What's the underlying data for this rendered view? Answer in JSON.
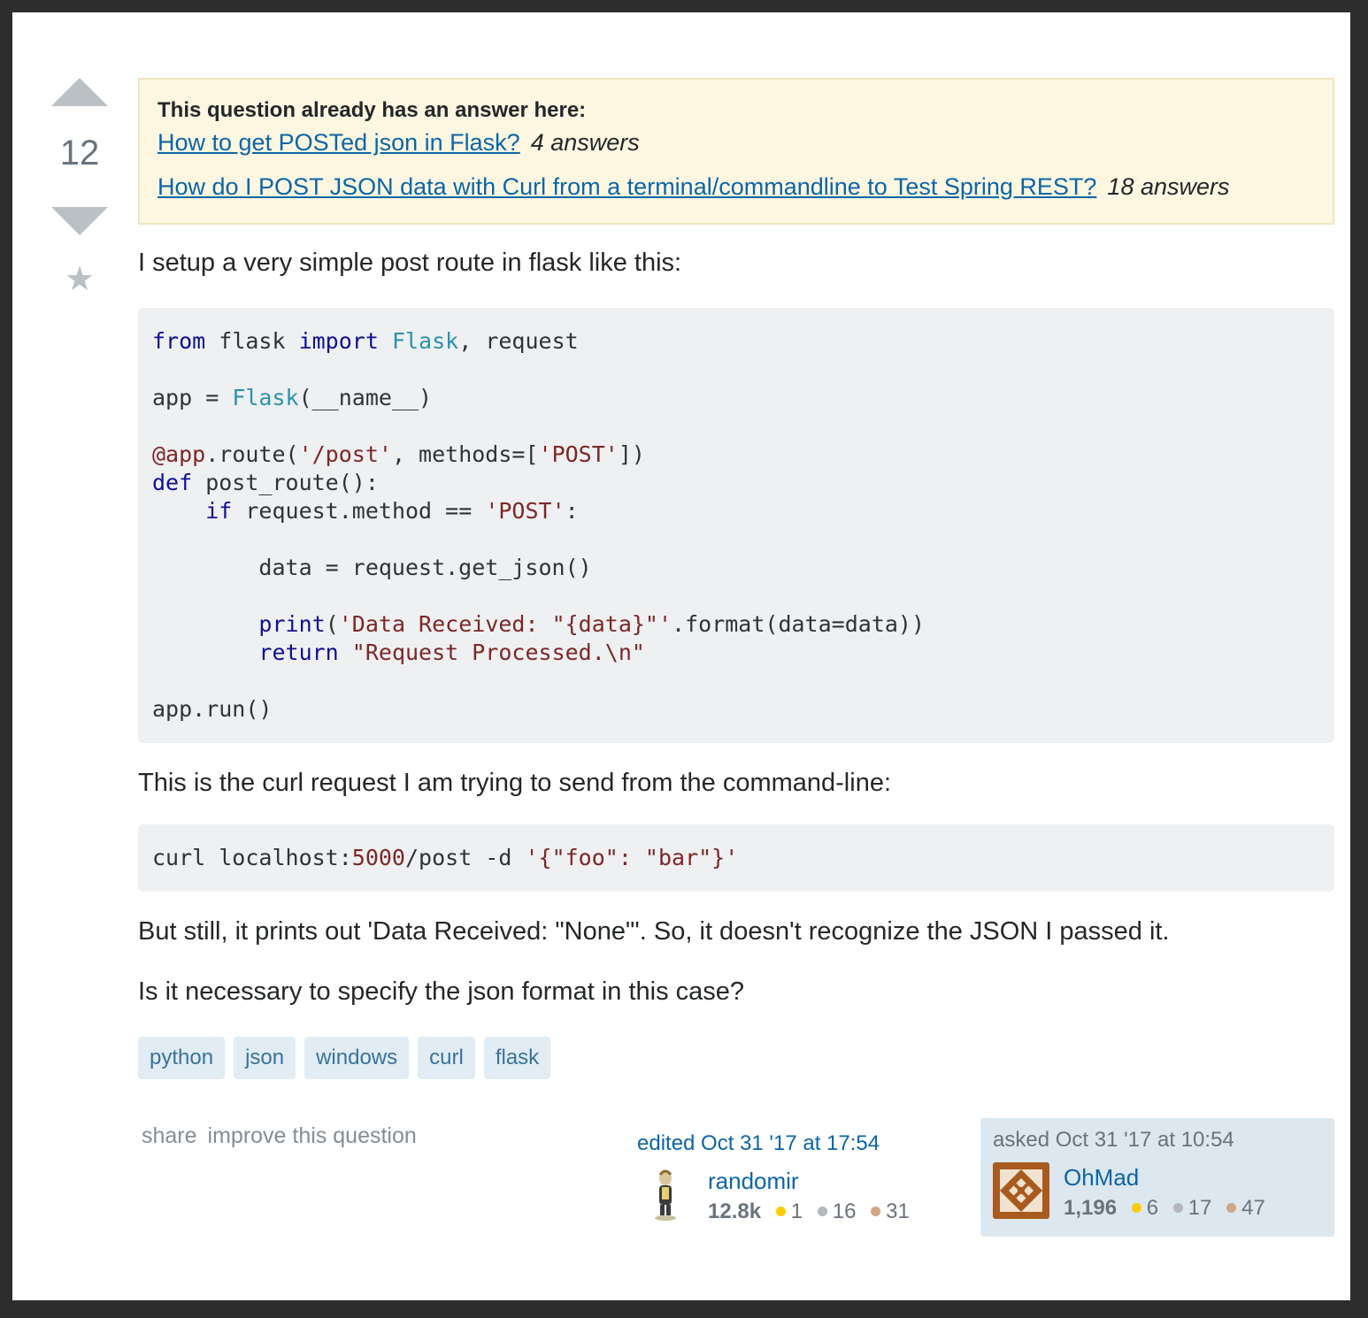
{
  "vote": {
    "count": "12"
  },
  "duplicate": {
    "title": "This question already has an answer here:",
    "items": [
      {
        "link": "How to get POSTed json in Flask?",
        "count": "4 answers"
      },
      {
        "link": "How do I POST JSON data with Curl from a terminal/commandline to Test Spring REST?",
        "count": "18 answers"
      }
    ]
  },
  "body": {
    "intro": "I setup a very simple post route in flask like this:",
    "code1": {
      "l1": [
        "from",
        " flask ",
        "import",
        " ",
        "Flask",
        ", request"
      ],
      "l2": [
        "app = ",
        "Flask",
        "(__name__)"
      ],
      "l3": [
        "@app",
        ".route(",
        "'/post'",
        ", methods=[",
        "'POST'",
        "])"
      ],
      "l4": [
        "def",
        " post_route():"
      ],
      "l5": [
        "    ",
        "if",
        " request.method == ",
        "'POST'",
        ":"
      ],
      "l6": "        data = request.get_json()",
      "l7": [
        "        ",
        "print",
        "(",
        "'Data Received: \"{data}\"'",
        ".format(data=data))"
      ],
      "l8": [
        "        ",
        "return",
        " ",
        "\"Request Processed.\\n\""
      ],
      "l9": "app.run()"
    },
    "curl_intro": "This is the curl request I am trying to send from the command-line:",
    "code2": [
      "curl localhost:",
      "5000",
      "/post -d ",
      "'{\"foo\": \"bar\"}'"
    ],
    "p3": "But still, it prints out 'Data Received: \"None\"'. So, it doesn't recognize the JSON I passed it.",
    "p4": "Is it necessary to specify the json format in this case?"
  },
  "tags": [
    "python",
    "json",
    "windows",
    "curl",
    "flask"
  ],
  "footer": {
    "share": "share",
    "improve": "improve this question",
    "edited": {
      "action": "edited Oct 31 '17 at 17:54",
      "user": "randomir",
      "rep": "12.8k",
      "gold": "1",
      "silver": "16",
      "bronze": "31"
    },
    "asked": {
      "action": "asked Oct 31 '17 at 10:54",
      "user": "OhMad",
      "rep": "1,196",
      "gold": "6",
      "silver": "17",
      "bronze": "47"
    }
  },
  "colors": {
    "link": "#0c65a5",
    "tag_bg": "#e1ecf4",
    "notice_bg": "#fdf7e2",
    "code_bg": "#eff0f1"
  }
}
